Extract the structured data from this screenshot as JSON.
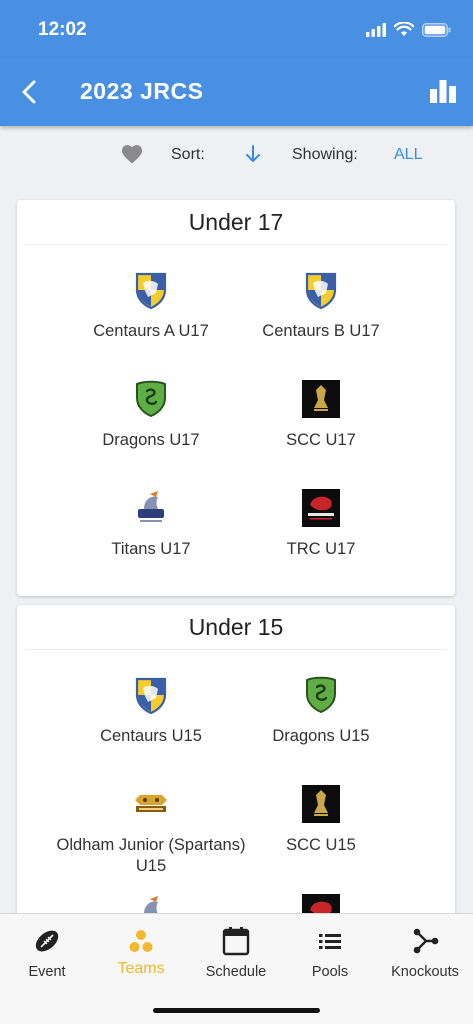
{
  "status_bar": {
    "time": "12:02"
  },
  "header": {
    "title": "2023 JRCS"
  },
  "filter": {
    "sort_label": "Sort:",
    "showing_label": "Showing:",
    "showing_value": "ALL"
  },
  "sections": [
    {
      "title": "Under 17",
      "teams": [
        {
          "name": "Centaurs A U17",
          "logo": "centaurs-shield"
        },
        {
          "name": "Centaurs B U17",
          "logo": "centaurs-shield"
        },
        {
          "name": "Dragons U17",
          "logo": "dragons-shield"
        },
        {
          "name": "SCC U17",
          "logo": "scc-crest"
        },
        {
          "name": "Titans U17",
          "logo": "titans-logo"
        },
        {
          "name": "TRC U17",
          "logo": "tanglin-logo"
        }
      ]
    },
    {
      "title": "Under 15",
      "teams": [
        {
          "name": "Centaurs U15",
          "logo": "centaurs-shield"
        },
        {
          "name": "Dragons U15",
          "logo": "dragons-shield"
        },
        {
          "name": "Oldham Junior (Spartans) U15",
          "logo": "spartans-logo"
        },
        {
          "name": "SCC U15",
          "logo": "scc-crest"
        }
      ]
    }
  ],
  "tabs": [
    {
      "label": "Event",
      "icon": "rugby-ball-icon"
    },
    {
      "label": "Teams",
      "icon": "teams-dots-icon",
      "active": true
    },
    {
      "label": "Schedule",
      "icon": "calendar-icon"
    },
    {
      "label": "Pools",
      "icon": "list-icon"
    },
    {
      "label": "Knockouts",
      "icon": "bracket-icon"
    }
  ],
  "colors": {
    "primary": "#4a90e2",
    "active_tab": "#f2b82e",
    "link": "#3b8de0"
  }
}
